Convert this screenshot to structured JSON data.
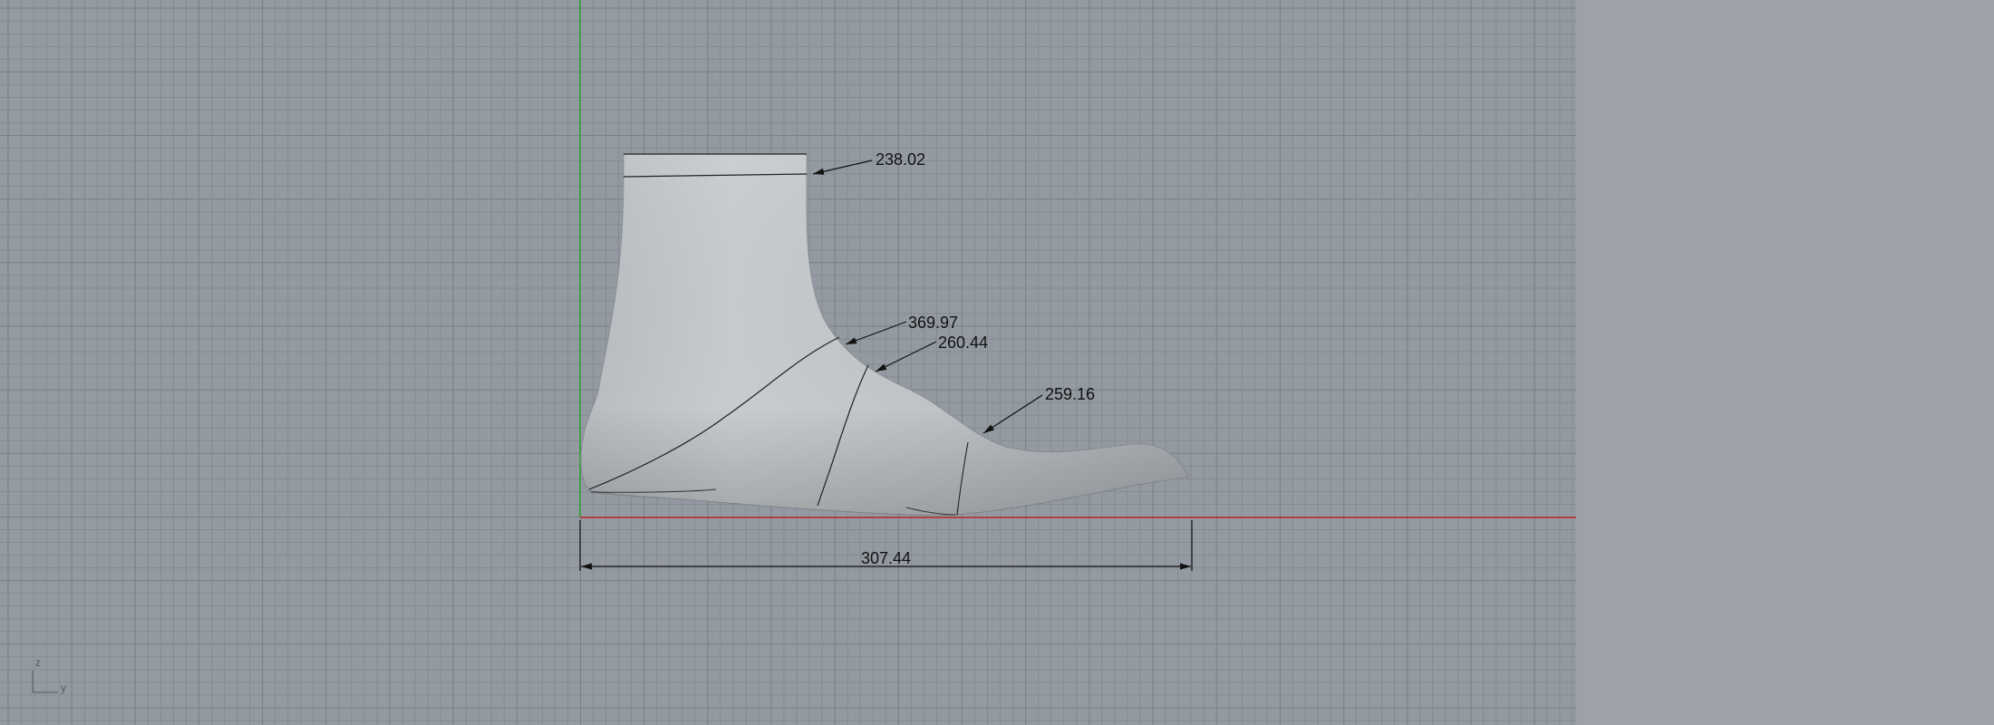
{
  "viewport": {
    "background_color": "#949aa2",
    "grid_color": "#7c828a",
    "x_axis_color": "#c0272d",
    "y_axis_color": "#2aa52a"
  },
  "side_panel": {
    "background_color": "#9ea2a8"
  },
  "dimensions": {
    "top_girth": "238.02",
    "instep_girth": "369.97",
    "waist_girth": "260.44",
    "ball_girth": "259.16",
    "length": "307.44"
  },
  "axis_gizmo": {
    "vertical_label": "z",
    "horizontal_label": "y"
  }
}
